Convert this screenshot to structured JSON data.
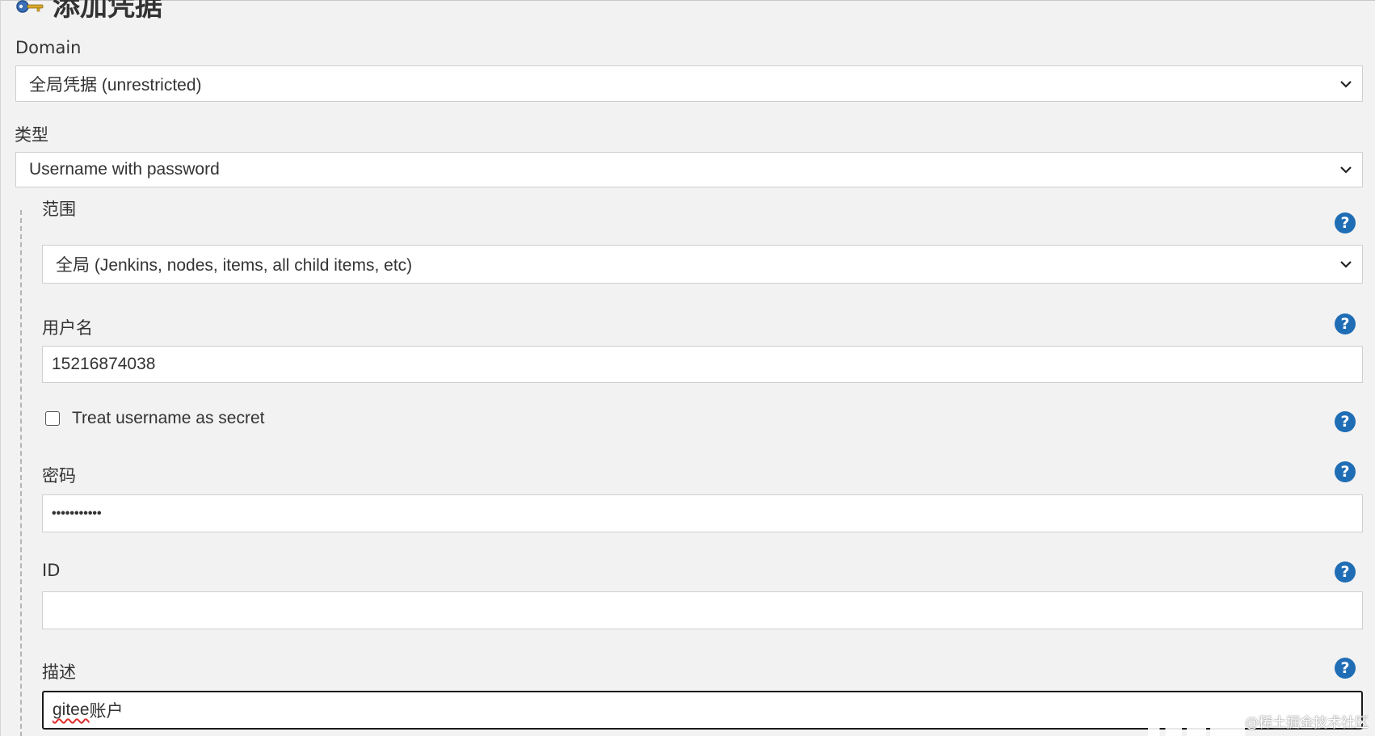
{
  "header": {
    "title": "添加凭据",
    "icon": "key-icon"
  },
  "domain": {
    "label": "Domain",
    "selected": "全局凭据 (unrestricted)"
  },
  "kind": {
    "label": "类型",
    "selected": "Username with password"
  },
  "scope": {
    "label": "范围",
    "selected": "全局 (Jenkins, nodes, items, all child items, etc)"
  },
  "username": {
    "label": "用户名",
    "value": "15216874038"
  },
  "treat_secret": {
    "label": "Treat username as secret",
    "checked": false
  },
  "password": {
    "label": "密码",
    "value": "•••••••••••"
  },
  "id_field": {
    "label": "ID",
    "value": ""
  },
  "description": {
    "label": "描述",
    "value_word": "gitee",
    "value_rest": "账户"
  },
  "help": {
    "glyph": "?"
  },
  "watermark": "@稀土掘金技术社区",
  "colors": {
    "help_icon": "#1f6db5",
    "background": "#f2f2f2",
    "field_border": "#cfcfcf"
  }
}
